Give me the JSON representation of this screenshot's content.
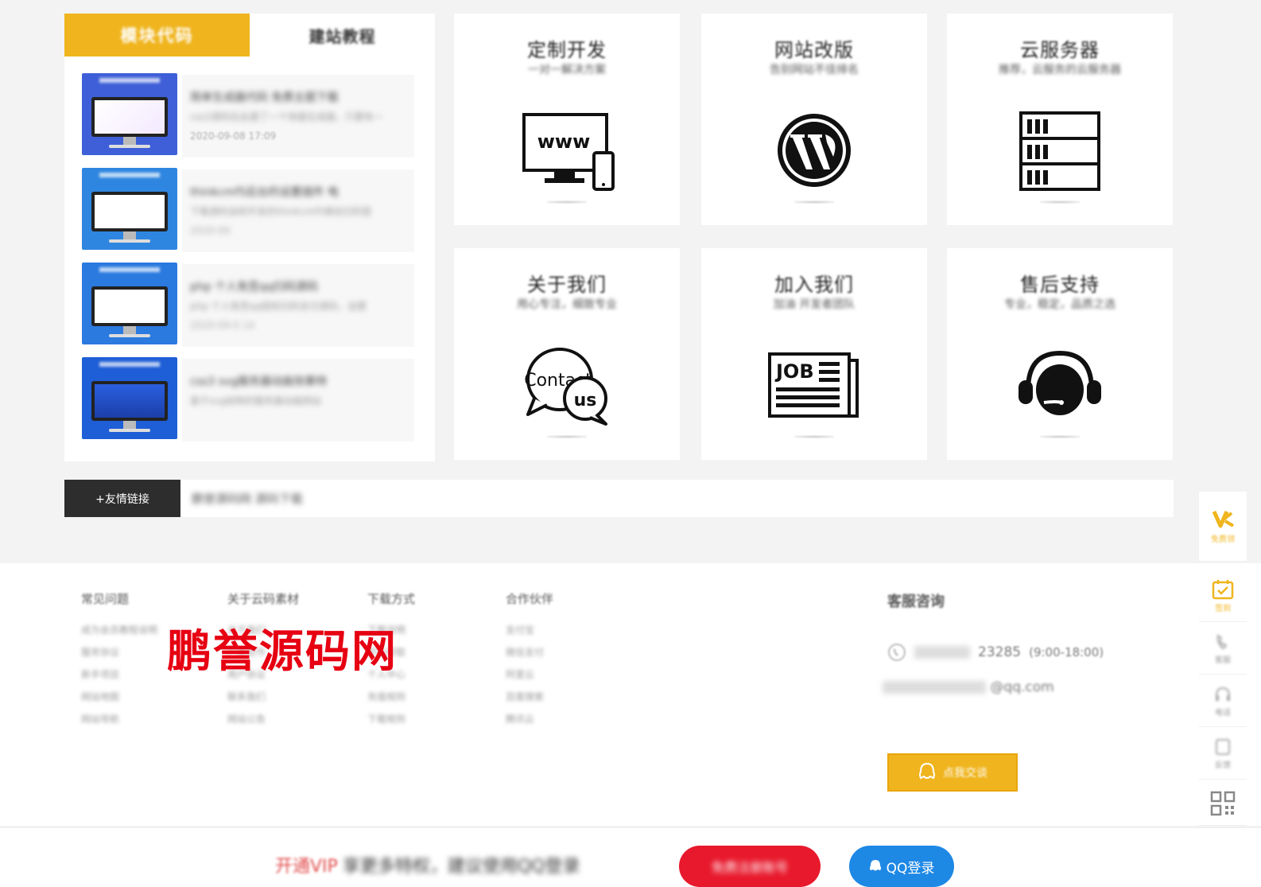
{
  "left_panel": {
    "tabs": [
      {
        "label": "模块代码",
        "active": true
      },
      {
        "label": "建站教程",
        "active": false
      }
    ],
    "articles": [
      {
        "title": "简单生成器代码 免费主题下载",
        "desc": "css3源码在此建了一个体器生成器，只要有一",
        "date": "2020-09-08 17:09",
        "thumb_color": "#3f5fd8"
      },
      {
        "title": "thinkcmf5后台的设置插件 电",
        "desc": "下载源码自研开发的thinkcmf5微信扫码登",
        "date": "2020-09",
        "thumb_color": "#2f86e0"
      },
      {
        "title": "php 个人免签qq扫码源码",
        "desc": "php 个人免签qq授权扫码支付源码，设置",
        "date": "2020-09-0 14",
        "thumb_color": "#2b7ae0"
      },
      {
        "title": "css3 svg服务器动画效果特",
        "desc": "基于svg绘制的服务器动画网站",
        "date": "",
        "thumb_color": "#1e5ed6"
      }
    ]
  },
  "cards": [
    {
      "title": "定制开发",
      "subtitle": "一对一解决方案",
      "icon": "www-monitor-icon"
    },
    {
      "title": "网站改版",
      "subtitle": "告别网站不佳排名",
      "icon": "wordpress-icon"
    },
    {
      "title": "云服务器",
      "subtitle": "推荐，云服务的云服务器",
      "icon": "server-rack-icon"
    },
    {
      "title": "关于我们",
      "subtitle": "用心专注，细致专业",
      "icon": "contact-us-icon"
    },
    {
      "title": "加入我们",
      "subtitle": "加油 开发者团队",
      "icon": "job-newspaper-icon"
    },
    {
      "title": "售后支持",
      "subtitle": "专业，稳定，品质之选",
      "icon": "headset-support-icon"
    }
  ],
  "links_bar": {
    "button_label": "+友情链接",
    "content": "鹏誉源码网  源码下载"
  },
  "footer": {
    "watermark": "鹏誉源码网",
    "columns": [
      {
        "title": "常见问题",
        "items": [
          "成为会员教程说明",
          "服务协议",
          "新手项目",
          "网站地图",
          "网站导航"
        ]
      },
      {
        "title": "关于云码素材",
        "items": [
          "关于我们",
          "广告合作",
          "用户协议",
          "联系我们",
          "网站公告"
        ]
      },
      {
        "title": "下载方式",
        "items": [
          "下载说明",
          "积分获取",
          "个人中心",
          "充值规则",
          "下载规则"
        ]
      },
      {
        "title": "合作伙伴",
        "items": [
          "支付宝",
          "微信支付",
          "阿里云",
          "百度搜索",
          "腾讯云"
        ]
      }
    ],
    "service": {
      "title": "客服咨询",
      "phone": "23285",
      "hours": "(9:00-18:00)",
      "email": "@qq.com",
      "button_label": "点我交谈"
    }
  },
  "side_bar": {
    "items": [
      {
        "label": "免费领",
        "icon": "v-logo-icon"
      },
      {
        "label": "签到",
        "icon": "calendar-check-icon"
      },
      {
        "label": "客服",
        "icon": "phone-icon"
      },
      {
        "label": "电话",
        "icon": "headset-icon"
      },
      {
        "label": "反馈",
        "icon": "feedback-icon"
      },
      {
        "label": "",
        "icon": "qrcode-icon"
      }
    ]
  },
  "bottom_bar": {
    "promo_vip": "开通VIP",
    "promo_text": "享更多特权，建议使用QQ登录",
    "register_label": "免费注册账号",
    "qq_label": "QQ登录"
  },
  "colors": {
    "accent": "#f0b51e",
    "dark": "#2d2d2d",
    "watermark_red": "#e60012",
    "qq_blue": "#1e88e5",
    "register_red": "#e8192c"
  }
}
